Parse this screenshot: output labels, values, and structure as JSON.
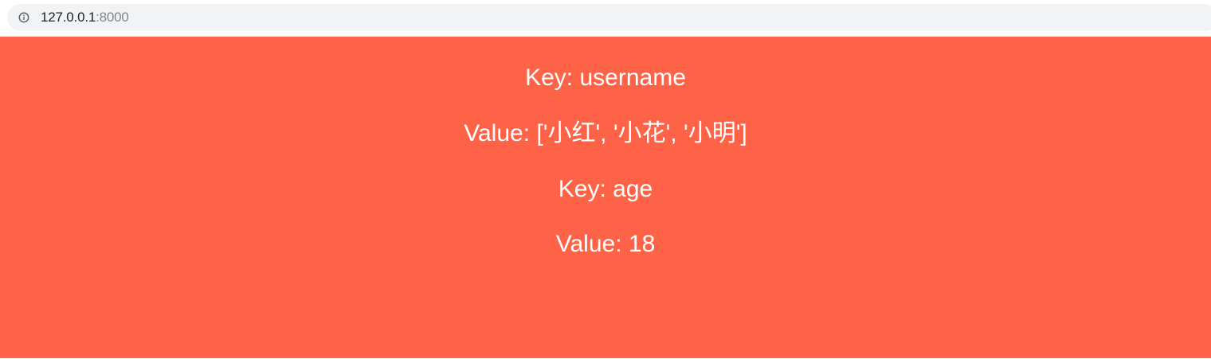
{
  "browser": {
    "address_bar": {
      "icon": "info-icon",
      "host": "127.0.0.1",
      "port": ":8000"
    }
  },
  "page": {
    "background_color": "#ff6347",
    "text_color": "#ffffff",
    "lines": [
      {
        "label": "Key: username"
      },
      {
        "label": "Value: ['小红', '小花', '小明']"
      },
      {
        "label": "Key: age"
      },
      {
        "label": "Value: 18"
      }
    ]
  }
}
